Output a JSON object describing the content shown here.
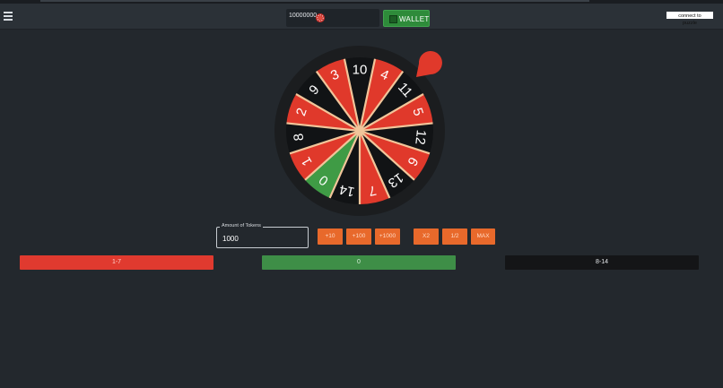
{
  "header": {
    "balance": "10000000",
    "wallet_label": "WALLET",
    "connect_label": "connect to puzzle"
  },
  "wheel": {
    "numbers": [
      "10",
      "4",
      "11",
      "5",
      "12",
      "6",
      "13",
      "7",
      "14",
      "0",
      "1",
      "8",
      "2",
      "9",
      "3"
    ],
    "colors": {
      "red": "#e0392b",
      "black": "#111315",
      "green": "#3f9b45",
      "divider": "#f1c59a",
      "rim": "#1b1d1f",
      "pointer": "#e0392b"
    }
  },
  "tokens": {
    "label": "Amount of Tokens",
    "value": "1000"
  },
  "buttons": {
    "plus10": "+10",
    "plus100": "+100",
    "plus1000": "+1000",
    "x2": "X2",
    "half": "1/2",
    "max": "MAX"
  },
  "bets": {
    "red": "1-7",
    "green": "0",
    "black": "8-14"
  },
  "bet_colors": {
    "red": "#e03a2f",
    "green": "#3e8e47",
    "black": "#141517"
  }
}
